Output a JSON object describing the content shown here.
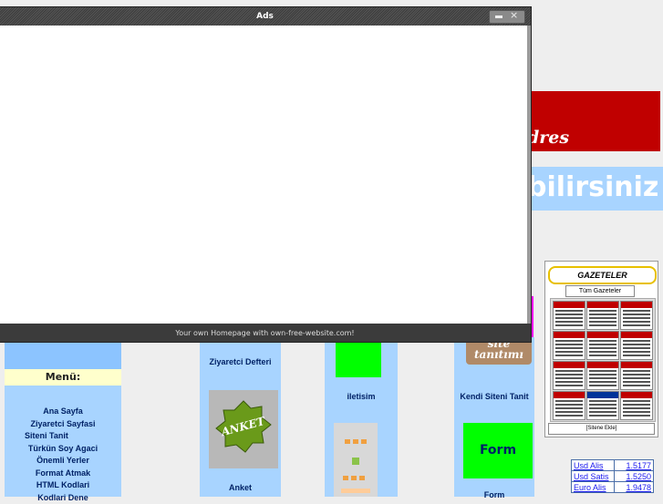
{
  "banner": {
    "red_text": "dres",
    "blue_text": "bilirsiniz"
  },
  "menu": {
    "heading": "Menü:",
    "items": [
      "Ana Sayfa",
      "Ziyaretci Sayfasi",
      "Siteni Tanit",
      "Türkün Soy Agaci",
      "Önemli Yerler",
      "Format Atmak",
      "HTML Kodlari",
      "Kodlari Dene"
    ]
  },
  "links": {
    "ziyaretci": "Ziyaretci Defteri",
    "anket": "Anket",
    "anket_image_text": "ANKET",
    "iletisim": "iletisim",
    "tanit_image_text": "site tanıtımı",
    "kendi": "Kendi Siteni Tanit",
    "form": "Form",
    "form2": "Form"
  },
  "gazeteler": {
    "title": "GAZETELER",
    "select": "Tüm Gazeteler",
    "footer": "[Sitene Ekle]"
  },
  "currency": [
    {
      "label": "Usd Alis",
      "value": "1.5177"
    },
    {
      "label": "Usd Satis",
      "value": "1.5250"
    },
    {
      "label": "Euro Alis",
      "value": "1.9478"
    }
  ],
  "ads_window": {
    "title": "Ads",
    "footer": "Your own Homepage with own-free-website.com!"
  },
  "colors": {
    "banner_red": "#c00000",
    "nav_blue": "#a8d4ff",
    "green": "#00ff00",
    "magenta": "#ff00ff"
  }
}
